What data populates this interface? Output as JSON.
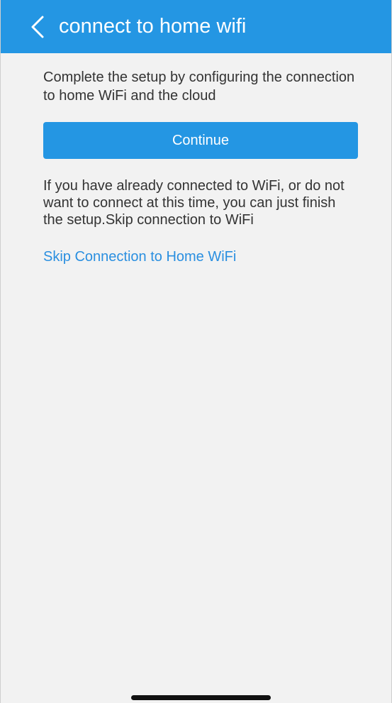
{
  "header": {
    "title": "connect to home wifi",
    "back_icon": "chevron-left-icon"
  },
  "main": {
    "intro_text": "Complete the setup by configuring the connection to home WiFi and the cloud",
    "continue_label": "Continue",
    "skip_note": "If you have already connected to WiFi, or do not want to connect at this time, you can just finish the setup.Skip connection to WiFi",
    "skip_link": "Skip Connection to Home WiFi"
  },
  "colors": {
    "accent": "#2496e3",
    "link": "#2a8fe0",
    "background": "#f2f2f2",
    "text": "#333333"
  }
}
